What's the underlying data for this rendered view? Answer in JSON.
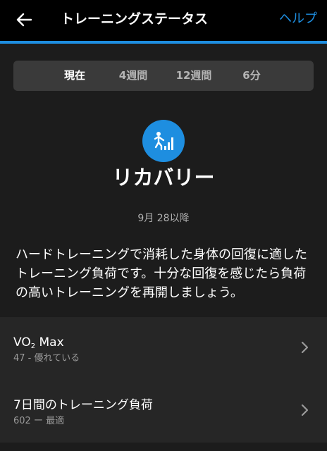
{
  "header": {
    "title": "トレーニングステータス",
    "help_label": "ヘルプ",
    "back_icon": "arrow-left-icon"
  },
  "colors": {
    "accent": "#1e8ee0",
    "panel": "#1c1c1c",
    "list_bg": "#262626"
  },
  "segments": {
    "items": [
      {
        "label": "現在",
        "active": true
      },
      {
        "label": "4週間",
        "active": false
      },
      {
        "label": "12週間",
        "active": false
      },
      {
        "label": "6分",
        "active": false
      }
    ]
  },
  "status": {
    "icon": "recovery-icon",
    "title": "リカバリー",
    "since": "9月 28以降",
    "description": "ハードトレーニングで消耗した身体の回復に適したトレーニング負荷です。十分な回復を感じたら負荷の高いトレーニングを再開しましょう。"
  },
  "list": {
    "items": [
      {
        "title_main": "VO",
        "title_sub": "2",
        "title_after": " Max",
        "subtitle": "47 - 優れている"
      },
      {
        "title": "7日間のトレーニング負荷",
        "subtitle": "602 ー 最適"
      }
    ]
  }
}
